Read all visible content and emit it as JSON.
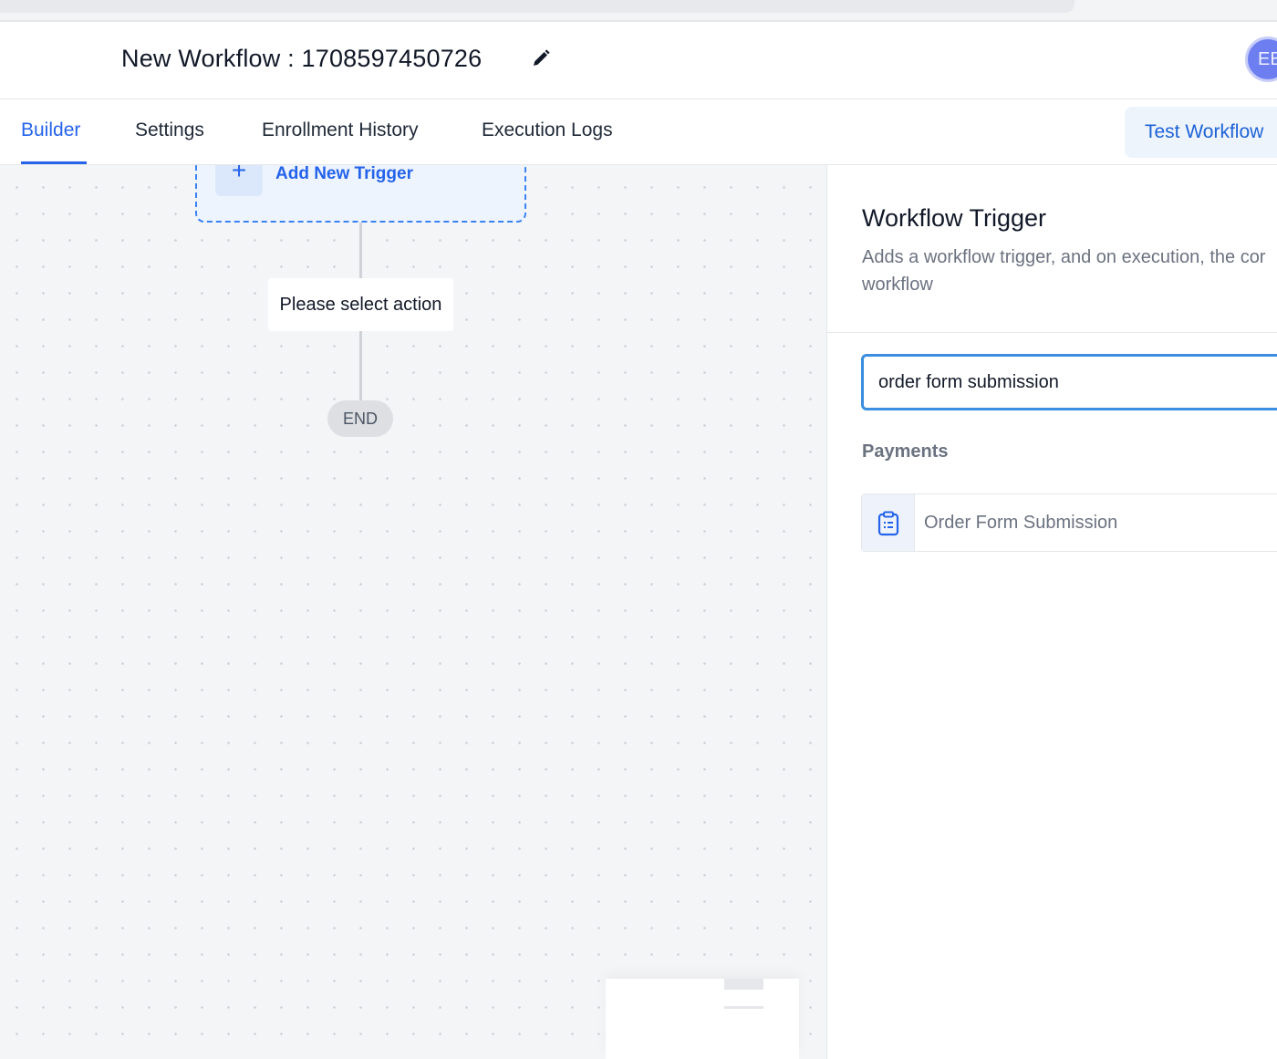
{
  "header": {
    "workflow_title": "New Workflow : 1708597450726",
    "avatar_initials": "EB"
  },
  "tabs": [
    {
      "label": "Builder",
      "active": true
    },
    {
      "label": "Settings",
      "active": false
    },
    {
      "label": "Enrollment History",
      "active": false
    },
    {
      "label": "Execution Logs",
      "active": false
    }
  ],
  "toolbar": {
    "test_workflow_label": "Test Workflow"
  },
  "canvas": {
    "add_trigger_label": "Add New Trigger",
    "action_placeholder": "Please select action",
    "end_label": "END"
  },
  "panel": {
    "title": "Workflow Trigger",
    "description_line1": "Adds a workflow trigger, and on execution, the cor",
    "description_line2": "workflow",
    "search_value": "order form submission",
    "group_label": "Payments",
    "results": [
      {
        "label": "Order Form Submission",
        "icon": "clipboard-icon"
      }
    ]
  },
  "colors": {
    "accent": "#2563eb",
    "active_tab": "#2563eb",
    "input_focus_border": "#3b8ee0",
    "avatar_bg": "#6d7ff0"
  }
}
